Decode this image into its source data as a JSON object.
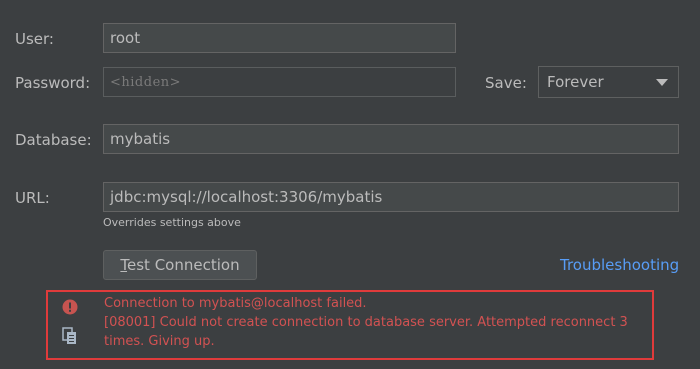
{
  "form": {
    "user_label": "User:",
    "user_value": "root",
    "password_label": "Password:",
    "password_placeholder": "<hidden>",
    "save_label": "Save:",
    "save_value": "Forever",
    "database_label": "Database:",
    "database_value": "mybatis",
    "url_label": "URL:",
    "url_value": "jdbc:mysql://localhost:3306/mybatis",
    "url_hint": "Overrides settings above"
  },
  "actions": {
    "test_connection_mnemonic": "T",
    "test_connection_rest": "est Connection",
    "troubleshooting_label": "Troubleshooting"
  },
  "error": {
    "line1": "Connection to mybatis@localhost failed.",
    "line2": "[08001] Could not create connection to database server. Attempted reconnect 3",
    "line3": "times. Giving up."
  },
  "icons": {
    "error": "error-circle-icon",
    "copy": "copy-icon"
  },
  "colors": {
    "background": "#3c3f41",
    "error_text": "#d25252",
    "error_border": "#e03b3b",
    "link": "#589df6"
  }
}
